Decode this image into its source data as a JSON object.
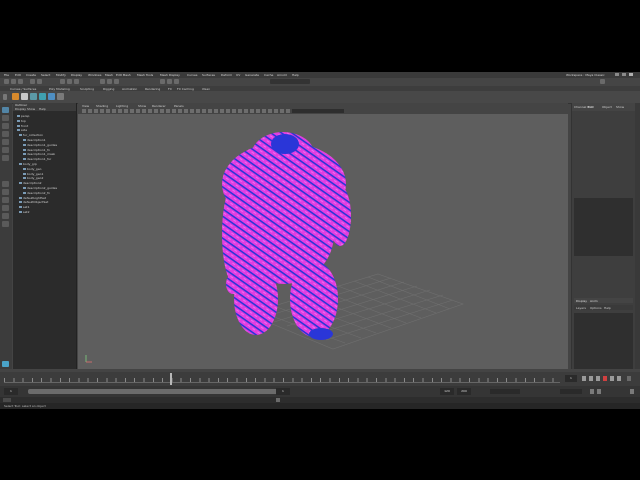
{
  "menubar": {
    "items": [
      "File",
      "Edit",
      "Create",
      "Select",
      "Modify",
      "Display",
      "Windows",
      "Mesh",
      "Edit Mesh",
      "Mesh Tools",
      "Mesh Display",
      "Curves",
      "Surfaces",
      "Deform",
      "UV",
      "Generate",
      "Cache",
      "Arnold",
      "Help"
    ],
    "workspace": "Workspace : Maya Classic"
  },
  "shelf_tabs": [
    "Curves / Surfaces",
    "Poly Modeling",
    "Sculpting",
    "Rigging",
    "Animation",
    "Rendering",
    "FX",
    "FX Caching",
    "XGen"
  ],
  "outliner": {
    "title": "Outliner",
    "menus": [
      "Display",
      "Show",
      "Help"
    ],
    "items": [
      "persp",
      "top",
      "front",
      "side",
      "fur_collection",
      "description1",
      "description1_guides",
      "description1_fx",
      "description1_mask",
      "description1_fur",
      "body_grp",
      "body_geo",
      "body_geo1",
      "body_geo2",
      "description2",
      "description2_guides",
      "description2_fx",
      "defaultLightSet",
      "defaultObjectSet",
      "set1",
      "set2"
    ]
  },
  "viewport": {
    "menus": [
      "View",
      "Shading",
      "Lighting",
      "Show",
      "Renderer",
      "Panels"
    ],
    "camera": "persp"
  },
  "channel_box": {
    "tabs": [
      "Channel Box",
      "Edit",
      "Object",
      "Show"
    ],
    "layer_tabs": [
      "Display",
      "Anim"
    ],
    "layer_menus": [
      "Layers",
      "Options",
      "Help"
    ]
  },
  "timeslider": {
    "current_frame": "1",
    "start": "1",
    "end": "120",
    "range_start": "1",
    "range_end": "200"
  },
  "helpline": {
    "text": "Select Tool: select an object"
  },
  "icons": {
    "shelf": [
      "polySphere-icon",
      "polyCube-icon",
      "polyCylinder-icon",
      "polyPlane-icon",
      "xgen-icon",
      "xgen-guide-icon"
    ],
    "tools": [
      "select-tool-icon",
      "lasso-tool-icon",
      "paint-select-icon",
      "move-tool-icon",
      "rotate-tool-icon",
      "scale-tool-icon",
      "last-tool-icon"
    ]
  },
  "colors": {
    "fur_primary": "#e23ee0",
    "fur_secondary": "#2a36d8",
    "viewport_bg": "#5e5e5e",
    "active_tool": "#5285a6"
  }
}
